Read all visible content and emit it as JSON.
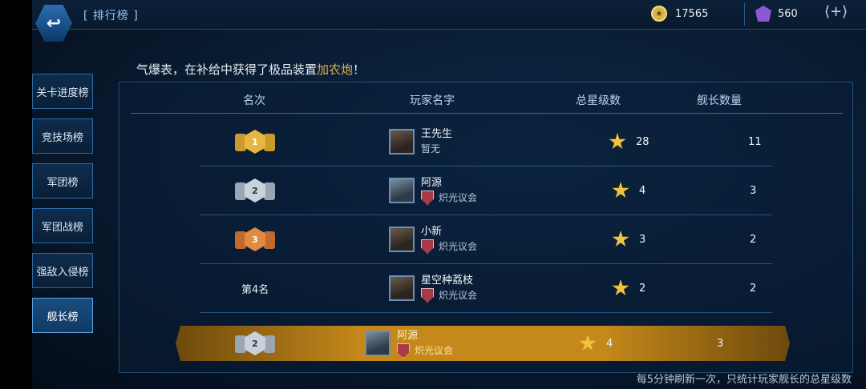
{
  "header": {
    "title": "[ 排行榜 ]",
    "coins": "17565",
    "gems": "560",
    "add_label": "+"
  },
  "sidebar": {
    "items": [
      {
        "label": "关卡进度榜"
      },
      {
        "label": "竞技场榜"
      },
      {
        "label": "军团榜"
      },
      {
        "label": "军团战榜"
      },
      {
        "label": "强敌入侵榜"
      },
      {
        "label": "舰长榜"
      }
    ],
    "active": "舰长榜"
  },
  "ticker": {
    "prefix": "气爆表，在补给中获得了极品装置",
    "item": "加农炮",
    "suffix": "！"
  },
  "table": {
    "headers": {
      "rank": "名次",
      "player": "玩家名字",
      "stars": "总星级数",
      "captains": "舰长数量"
    },
    "rows": [
      {
        "rank_badge": "1",
        "name": "王先生",
        "guild": "暂无",
        "stars": "28",
        "captains": "11"
      },
      {
        "rank_badge": "2",
        "name": "阿源",
        "guild": "炽光议会",
        "stars": "4",
        "captains": "3"
      },
      {
        "rank_badge": "3",
        "name": "小新",
        "guild": "炽光议会",
        "stars": "3",
        "captains": "2"
      },
      {
        "rank_text": "第4名",
        "name": "星空种荔枝",
        "guild": "炽光议会",
        "stars": "2",
        "captains": "2"
      }
    ],
    "mine": {
      "rank_badge": "2",
      "name": "阿源",
      "guild": "炽光议会",
      "stars": "4",
      "captains": "3"
    }
  },
  "footer": {
    "note": "每5分钟刷新一次，只统计玩家舰长的总星级数"
  },
  "colors": {
    "gold": "#e0b052",
    "accent": "#58a3e6",
    "highlight_row": "#c4881b"
  }
}
